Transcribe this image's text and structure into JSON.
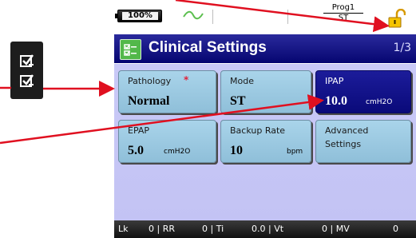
{
  "left_icon": "checklist-icon",
  "status": {
    "battery_text": "100%",
    "program_label": "Prog1",
    "mode_short": "ST",
    "lock_icon": "unlocked-padlock-icon"
  },
  "title": {
    "icon": "clinical-settings-icon",
    "text": "Clinical Settings",
    "page": "1/3"
  },
  "tiles": [
    {
      "label": "Pathology",
      "value": "Normal",
      "unit": "",
      "required": "*"
    },
    {
      "label": "Mode",
      "value": "ST",
      "unit": ""
    },
    {
      "label": "IPAP",
      "value": "10.0",
      "unit": "cmH2O"
    },
    {
      "label": "EPAP",
      "value": "5.0",
      "unit": "cmH2O"
    },
    {
      "label": "Backup Rate",
      "value": "10",
      "unit": "bpm"
    },
    {
      "label": "Advanced",
      "label2": "Settings"
    }
  ],
  "bottom": [
    {
      "text": "Lk"
    },
    {
      "text": "0 | RR"
    },
    {
      "text": "0 | Ti"
    },
    {
      "text": "0.0 | Vt"
    },
    {
      "text": "0 | MV"
    },
    {
      "text": "0"
    }
  ],
  "colors": {
    "title_bar": "#0a0a78",
    "content_bg": "#c6c6f5",
    "tile": "#9ccbe3",
    "tile_selected": "#12128a",
    "arrow": "#e01020",
    "icon_green": "#52b84a"
  }
}
